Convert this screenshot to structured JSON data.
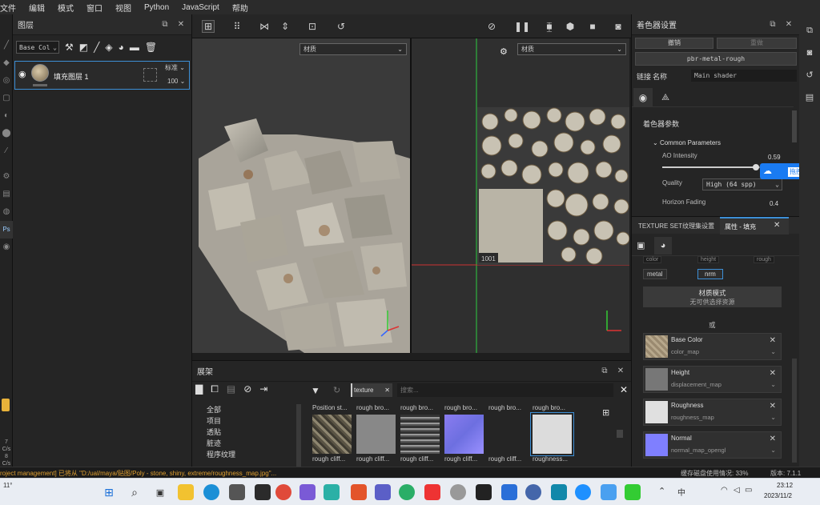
{
  "menubar": {
    "items": [
      "文件",
      "编辑",
      "模式",
      "窗口",
      "视图",
      "Python",
      "JavaScript",
      "帮助"
    ]
  },
  "layers_panel": {
    "title": "图层",
    "blend_select": "Base Col",
    "layer": {
      "name": "填充图层 1",
      "blend": "标准",
      "opacity": "100"
    }
  },
  "viewport": {
    "left_material_select": "材质",
    "right_material_select": "材质",
    "uv_tile": "1001"
  },
  "shelf": {
    "title": "展架",
    "search_chip": "texture",
    "search_placeholder": "搜索...",
    "categories": [
      "全部",
      "项目",
      "透贴",
      "脏迹",
      "程序纹理"
    ],
    "thumb_top_labels": [
      "Position st...",
      "rough bro...",
      "rough bro...",
      "rough bro...",
      "rough bro...",
      "rough bro..."
    ],
    "thumb_bottom_labels": [
      "rough cliff...",
      "rough cliff...",
      "rough cliff...",
      "rough cliff...",
      "rough cliff...",
      "roughness..."
    ]
  },
  "shader_settings": {
    "title": "着色器设置",
    "undo": "撤销",
    "redo": "重做",
    "shader_name": "pbr-metal-rough",
    "link_label": "链接",
    "name_label": "名称",
    "name_value": "Main shader",
    "section": "着色器参数",
    "group": "Common Parameters",
    "ao_label": "AO Intensity",
    "ao_value": "0.59",
    "ao_fraction": 0.78,
    "quality_label": "Quality",
    "quality_value": "High (64 spp)",
    "horizon_label": "Horizon Fading",
    "horizon_value": "0.4",
    "upload_label": "拖拽上传"
  },
  "properties": {
    "tab_texture_set": "TEXTURE SET纹理集设置",
    "tab_props": "属性 - 填充",
    "channels_top": [
      "color",
      "height",
      "rough"
    ],
    "channels": [
      "metal",
      "nrm"
    ],
    "material_mode_title": "材质模式",
    "material_mode_sub": "无可供选择资源",
    "or_label": "或",
    "slots": [
      {
        "name": "Base Color",
        "map": "color_map",
        "color": "#9a8a70"
      },
      {
        "name": "Height",
        "map": "displacement_map",
        "color": "#777777"
      },
      {
        "name": "Roughness",
        "map": "roughness_map",
        "color": "#e0e0e0"
      },
      {
        "name": "Normal",
        "map": "normal_map_opengl",
        "color": "#7f7fff"
      }
    ]
  },
  "statusbar": {
    "message": "roject management] 已将从 \"D:/ual/maya/贴图/Poly - stone, shiny, extreme/roughness_map.jpg\"...",
    "cache": "缓存磁盘使用情况: 33%",
    "version": "版本: 7.1.1"
  },
  "taskbar": {
    "weather": "11°",
    "time": "23:12",
    "date": "2023/11/2"
  },
  "left_edge_values": [
    "7",
    "C/s",
    "8",
    "C/s"
  ]
}
